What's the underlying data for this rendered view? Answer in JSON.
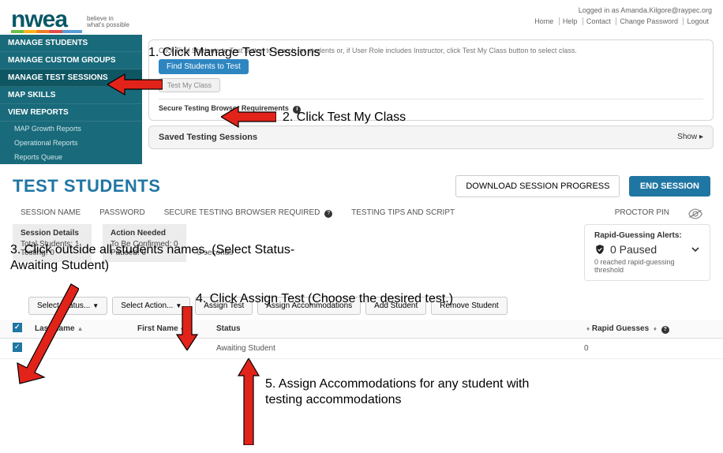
{
  "header": {
    "logo": "nwea",
    "tagline": "believe in\nwhat's possible",
    "logged_in": "Logged in as Amanda.Kilgore@raypec.org",
    "links": [
      "Home",
      "Help",
      "Contact",
      "Change Password",
      "Logout"
    ]
  },
  "sidebar": {
    "items": [
      {
        "label": "MANAGE STUDENTS"
      },
      {
        "label": "MANAGE CUSTOM GROUPS"
      },
      {
        "label": "MANAGE TEST SESSIONS"
      },
      {
        "label": "MAP SKILLS"
      },
      {
        "label": "VIEW REPORTS"
      }
    ],
    "reports": [
      {
        "label": "MAP Growth Reports"
      },
      {
        "label": "Operational Reports"
      },
      {
        "label": "Reports Queue"
      }
    ]
  },
  "main": {
    "hint": "Click Find Students to Test button to search for students or, if User Role includes Instructor, click Test My Class button to select class.",
    "find_btn": "Find Students to Test",
    "test_my_class": "Test My Class",
    "req": "Secure Testing Browser Requirements",
    "saved": "Saved Testing Sessions",
    "show": "Show"
  },
  "instructions": {
    "s1": "1.    Click Manage Test Sessions",
    "s2": "2.  Click Test My Class",
    "s3a": "3.  Click outside all students names. (Select Status-",
    "s3b": "Awaiting Student)",
    "s4": "4.  Click Assign Test (Choose the desired test.)",
    "s5a": "5.  Assign Accommodations for any student with",
    "s5b": "testing accommodations"
  },
  "test_students": {
    "title": "TEST STUDENTS",
    "download": "DOWNLOAD SESSION PROGRESS",
    "end": "END SESSION",
    "tabs": [
      "SESSION NAME",
      "PASSWORD",
      "SECURE TESTING BROWSER REQUIRED",
      "TESTING TIPS AND SCRIPT"
    ],
    "proctor": "PROCTOR PIN",
    "details": {
      "hdr1": "Session Details",
      "l1a": "Total Students: 1",
      "l1b": "Testing: 0",
      "hdr2": "Action Needed",
      "l2a": "To Be Confirmed: 0",
      "l2b": "Paused: 0"
    },
    "seconds": "0 seconds",
    "rapid": {
      "title": "Rapid-Guessing Alerts:",
      "paused": "0 Paused",
      "note": "0 reached rapid-guessing threshold"
    },
    "actions": {
      "select_status": "Select Status...",
      "select_action": "Select Action...",
      "assign_test": "Assign Test",
      "assign_accom": "Assign Accommodations",
      "add_student": "Add Student",
      "remove_student": "Remove Student"
    },
    "columns": {
      "last": "Last Name",
      "first": "First Name",
      "status": "Status",
      "rapid": "Rapid Guesses"
    },
    "row": {
      "status": "Awaiting Student",
      "rapid": "0"
    }
  }
}
